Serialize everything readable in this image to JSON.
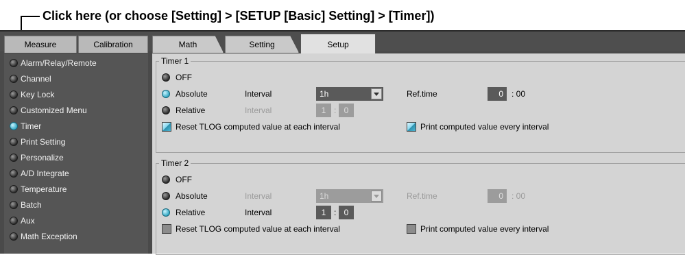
{
  "annotation": {
    "text": "Click here (or choose [Setting] > [SETUP [Basic] Setting] > [Timer])"
  },
  "tabs": [
    {
      "label": "Measure"
    },
    {
      "label": "Calibration"
    },
    {
      "label": "Math"
    },
    {
      "label": "Setting"
    },
    {
      "label": "Setup",
      "active": true
    }
  ],
  "sidebar": {
    "items": [
      {
        "label": "Alarm/Relay/Remote",
        "selected": false
      },
      {
        "label": "Channel",
        "selected": false
      },
      {
        "label": "Key Lock",
        "selected": false
      },
      {
        "label": "Customized Menu",
        "selected": false
      },
      {
        "label": "Timer",
        "selected": true
      },
      {
        "label": "Print Setting",
        "selected": false
      },
      {
        "label": "Personalize",
        "selected": false
      },
      {
        "label": "A/D Integrate",
        "selected": false
      },
      {
        "label": "Temperature",
        "selected": false
      },
      {
        "label": "Batch",
        "selected": false
      },
      {
        "label": "Aux",
        "selected": false
      },
      {
        "label": "Math Exception",
        "selected": false
      }
    ]
  },
  "timer1": {
    "title": "Timer 1",
    "off_label": "OFF",
    "absolute_label": "Absolute",
    "relative_label": "Relative",
    "mode": "Absolute",
    "abs_interval_label": "Interval",
    "abs_interval_value": "1h",
    "reftime_label": "Ref.time",
    "reftime_hour": "0",
    "reftime_min": ": 00",
    "rel_interval_label": "Interval",
    "rel_hour": "1",
    "rel_min": "0",
    "reset_label": "Reset TLOG computed value at each interval",
    "reset_checked": true,
    "print_label": "Print computed value every interval",
    "print_checked": true
  },
  "timer2": {
    "title": "Timer 2",
    "off_label": "OFF",
    "absolute_label": "Absolute",
    "relative_label": "Relative",
    "mode": "Relative",
    "abs_interval_label": "Interval",
    "abs_interval_value": "1h",
    "reftime_label": "Ref.time",
    "reftime_hour": "0",
    "reftime_min": ": 00",
    "rel_interval_label": "Interval",
    "rel_hour": "1",
    "rel_min": "0",
    "reset_label": "Reset TLOG computed value at each interval",
    "reset_checked": false,
    "print_label": "Print computed value every interval",
    "print_checked": false
  },
  "colors": {
    "accent_led_on": "#35a9c4",
    "window_bg": "#4a4a4a",
    "panel_bg": "#d4d4d4"
  }
}
